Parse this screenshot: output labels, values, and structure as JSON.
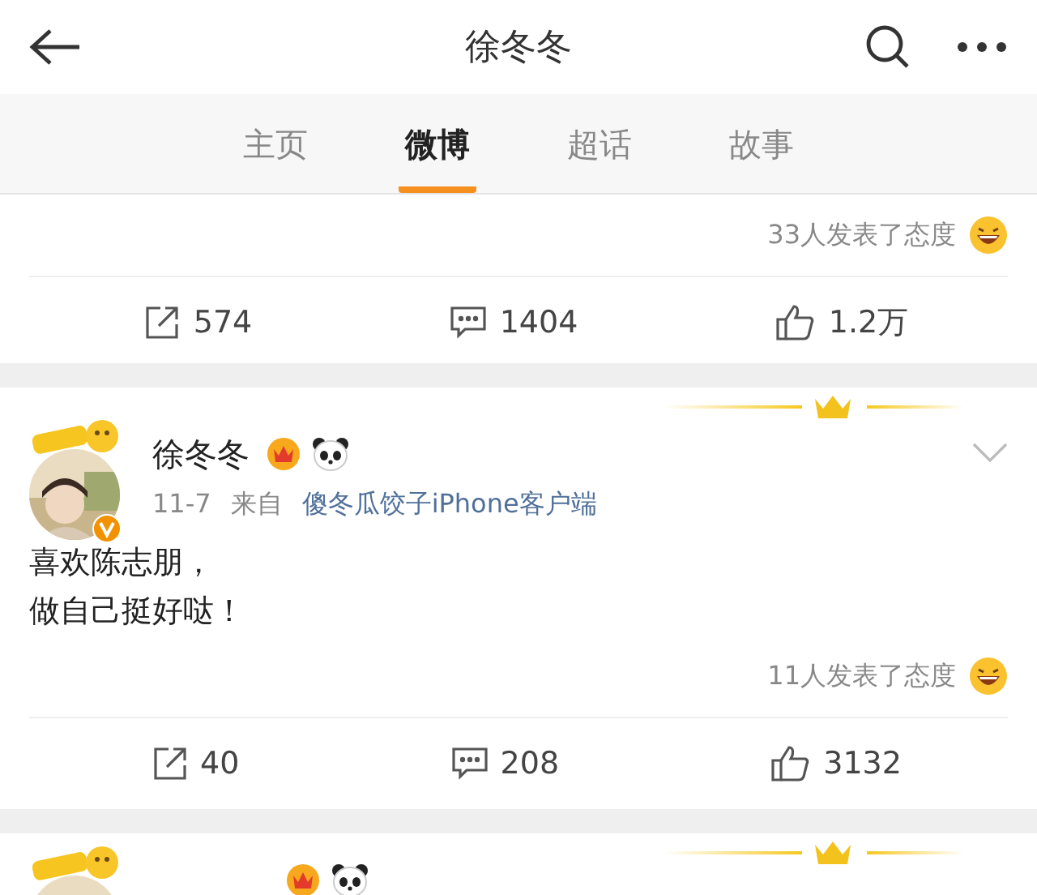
{
  "header": {
    "title": "徐冬冬"
  },
  "tabs": [
    {
      "label": "主页",
      "selected": false
    },
    {
      "label": "微博",
      "selected": true
    },
    {
      "label": "超话",
      "selected": false
    },
    {
      "label": "故事",
      "selected": false
    }
  ],
  "posts": [
    {
      "kind": "tail",
      "reactions": "33人发表了态度",
      "actions": [
        {
          "kind": "repost",
          "count": "574"
        },
        {
          "kind": "comment",
          "count": "1404"
        },
        {
          "kind": "like",
          "count": "1.2万"
        }
      ]
    },
    {
      "kind": "full",
      "author": "徐冬冬",
      "crown": true,
      "date": "11-7",
      "source_prefix": "来自",
      "source": "傻冬瓜饺子iPhone客户端",
      "lines": [
        "喜欢陈志朋，",
        "做自己挺好哒！"
      ],
      "reactions": "11人发表了态度",
      "actions": [
        {
          "kind": "repost",
          "count": "40"
        },
        {
          "kind": "comment",
          "count": "208"
        },
        {
          "kind": "like",
          "count": "3132"
        }
      ]
    },
    {
      "kind": "partial",
      "crown": true
    }
  ]
}
